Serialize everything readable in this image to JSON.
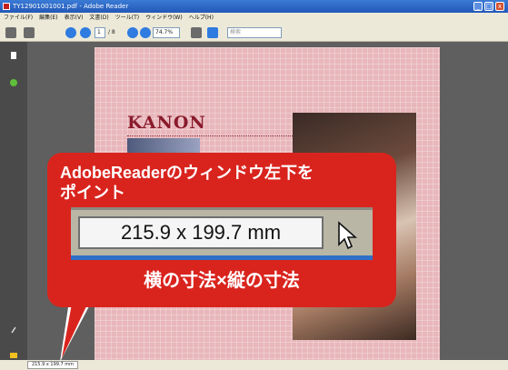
{
  "window": {
    "title": "TY12901001001.pdf - Adobe Reader",
    "controls": [
      "_",
      "□",
      "x"
    ]
  },
  "menubar": {
    "items": [
      "ファイル(F)",
      "編集(E)",
      "表示(V)",
      "文書(D)",
      "ツール(T)",
      "ウィンドウ(W)",
      "ヘルプ(H)"
    ]
  },
  "toolbar": {
    "print_icon": "printer-icon",
    "tools_icon": "hand-tool-icon",
    "page_current": "1",
    "page_total": "/ 8",
    "zoom_value": "74.7%",
    "search_placeholder": "検索"
  },
  "document": {
    "heading": "KANON"
  },
  "statusbar": {
    "page_size": "215.9 x 199.7 mm"
  },
  "callout": {
    "line1": "AdobeReaderのウィンドウ左下を",
    "line2": "ポイント",
    "size_readout": "215.9 x 199.7 mm",
    "caption": "横の寸法×縦の寸法"
  },
  "colors": {
    "callout_red": "#d9241e",
    "page_pink": "#e8b7bb",
    "heading_dark_red": "#8a1a2c"
  }
}
